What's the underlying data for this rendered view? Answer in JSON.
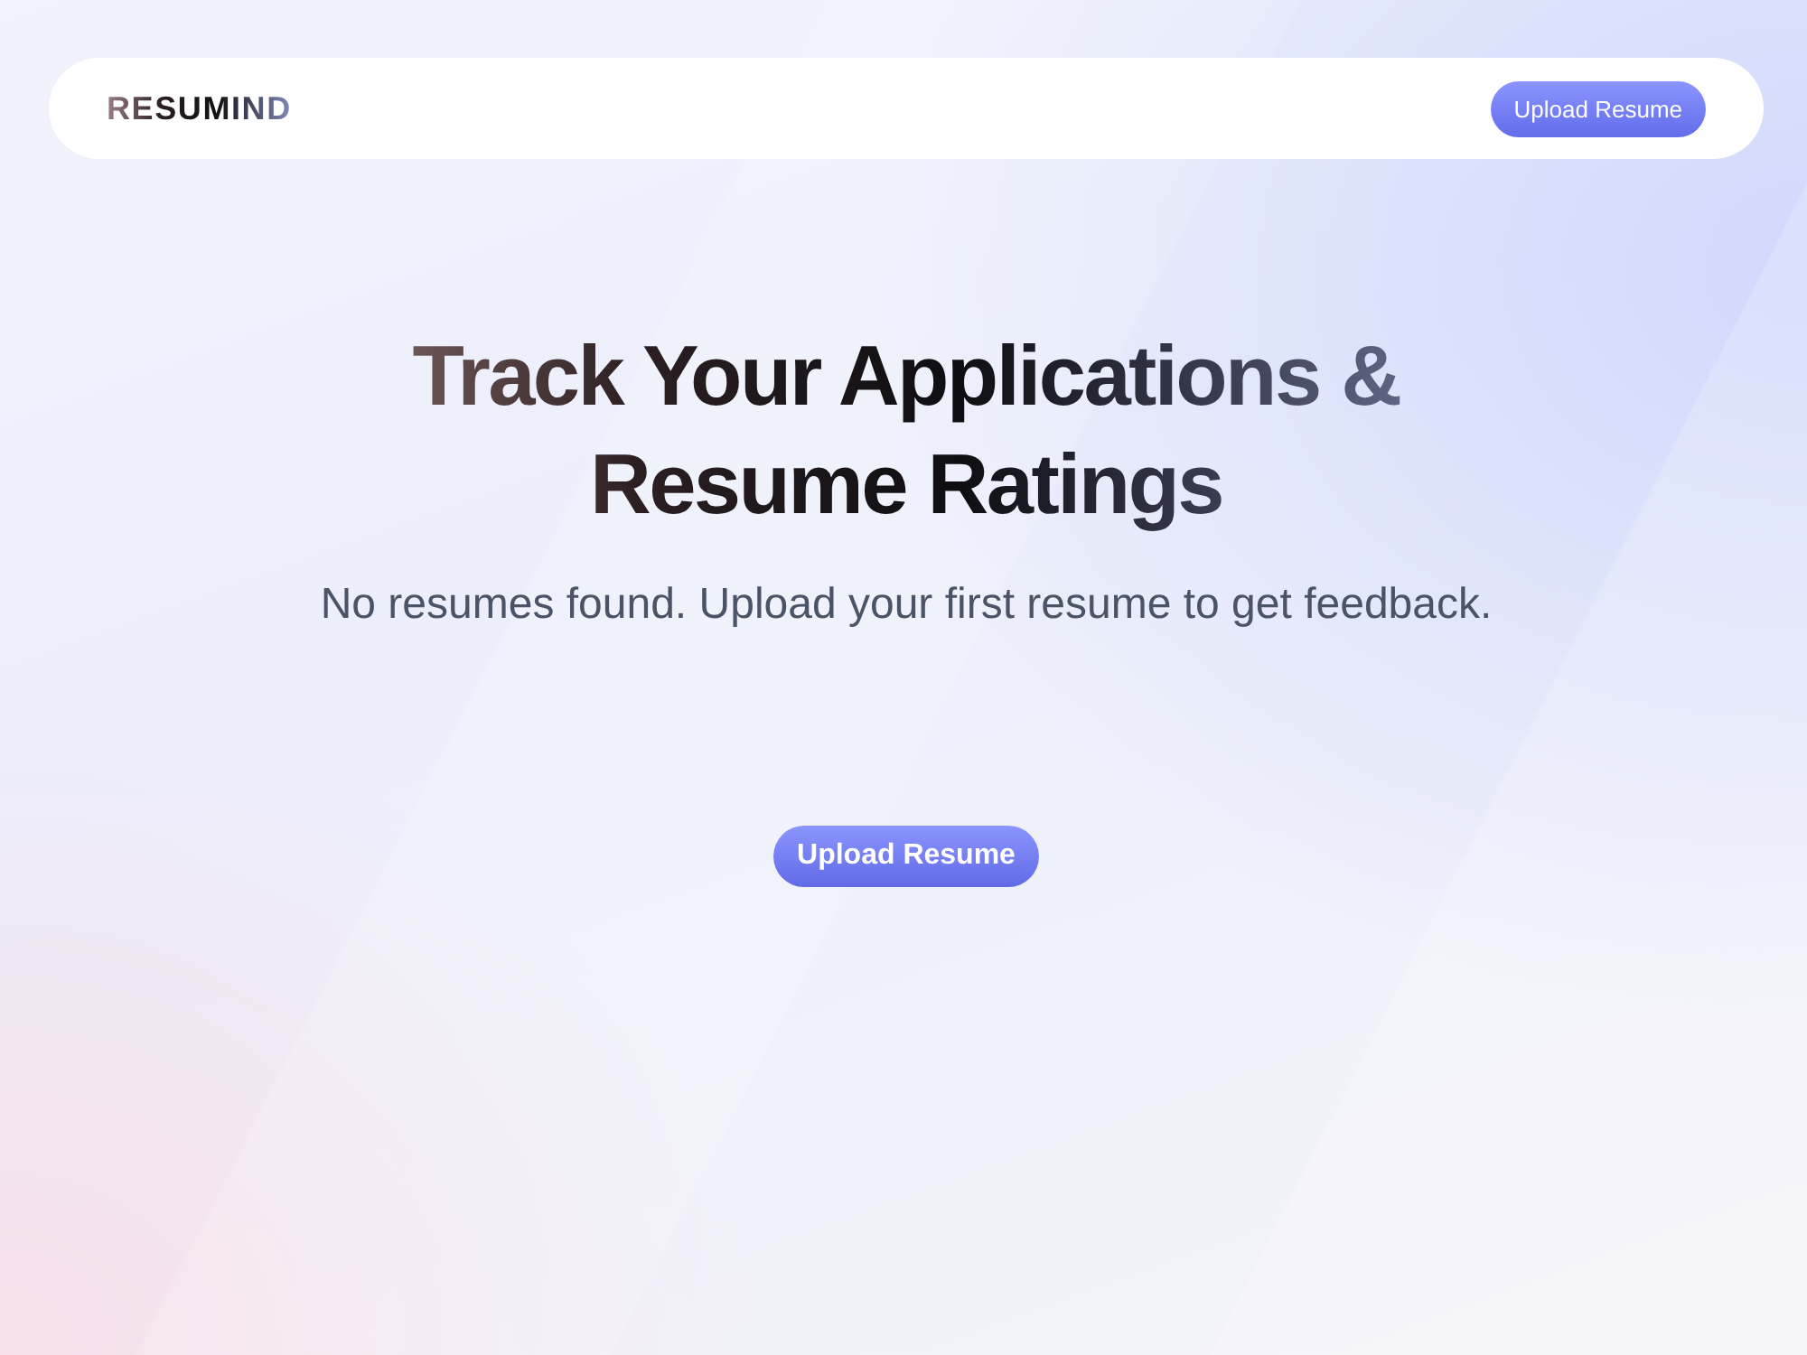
{
  "navbar": {
    "brand": "RESUMIND",
    "button": "Upload Resume"
  },
  "hero": {
    "title": "Track Your Applications & Resume Ratings",
    "subtitle": "No resumes found. Upload your first resume to get feedback.",
    "button": "Upload Resume"
  }
}
